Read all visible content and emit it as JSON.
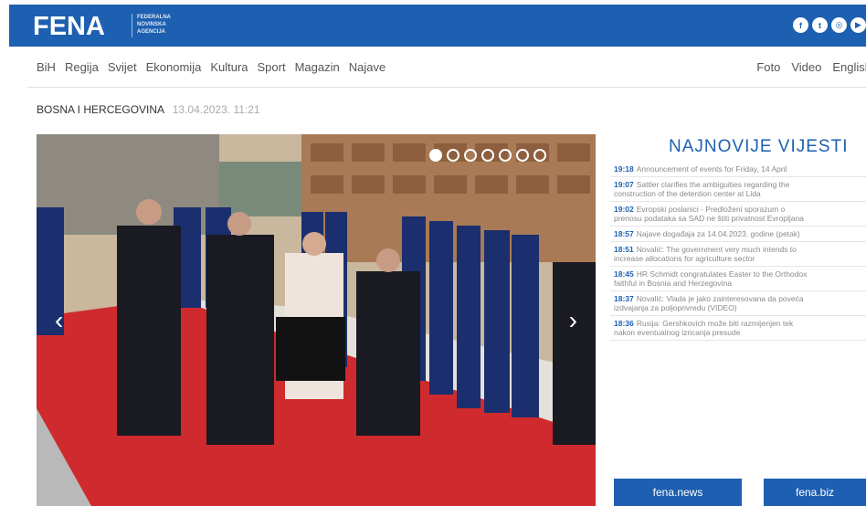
{
  "header": {
    "logo": "FENA",
    "logo_sub": [
      "FEDERALNA",
      "NOVINSKA",
      "AGENCIJA"
    ],
    "social_icons": [
      "facebook-icon",
      "twitter-icon",
      "instagram-icon",
      "youtube-icon"
    ],
    "brand_color": "#1d5fb0"
  },
  "nav": {
    "left": [
      "BiH",
      "Regija",
      "Svijet",
      "Ekonomija",
      "Kultura",
      "Sport",
      "Magazin",
      "Najave"
    ],
    "right": [
      "Foto",
      "Video",
      "English"
    ]
  },
  "breadcrumb": {
    "section": "BOSNA I HERCEGOVINA",
    "date": "13.04.2023. 11:21"
  },
  "slider": {
    "active_index": 0,
    "dot_count": 7
  },
  "latest": {
    "title": "NAJNOVIJE VIJESTI",
    "items": [
      {
        "time": "19:18",
        "lines": [
          "Announcement of events for Friday, 14 April"
        ]
      },
      {
        "time": "19:07",
        "lines": [
          "Sattler clarifies the ambiguities regarding the",
          "construction of the detention center at Lida"
        ]
      },
      {
        "time": "19:02",
        "lines": [
          "Evropski poslanici - Predloženi sporazum o",
          "prenosu podataka sa SAD ne štiti privatnost Evropljana"
        ]
      },
      {
        "time": "18:57",
        "lines": [
          "Najave događaja za 14.04.2023. godine (petak)"
        ]
      },
      {
        "time": "18:51",
        "lines": [
          "Novalić: The government very much intends to",
          "increase allocations for agriculture sector"
        ]
      },
      {
        "time": "18:45",
        "lines": [
          "HR Schmidt congratulates Easter to the Orthodox",
          "faithful in Bosnia and Herzegovina"
        ]
      },
      {
        "time": "18:37",
        "lines": [
          "Novalić: Vlada je jako zainteresovana da poveća",
          "izdvajanja za poljoprivredu (VIDEO)"
        ]
      },
      {
        "time": "18:36",
        "lines": [
          "Rusija: Gershkovich može biti razmijenjen tek",
          "nakon eventualnog izricanja presude"
        ]
      }
    ],
    "buttons": [
      "fena.news",
      "fena.biz"
    ]
  }
}
